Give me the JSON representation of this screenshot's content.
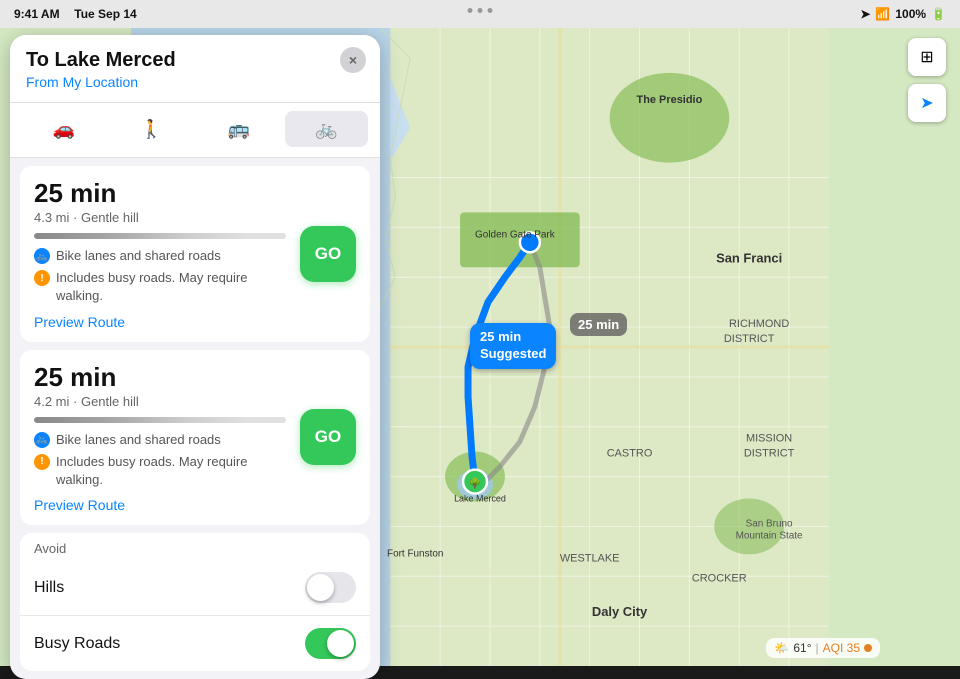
{
  "statusBar": {
    "time": "9:41 AM",
    "date": "Tue Sep 14",
    "signal": "●●●",
    "wifi": "WiFi",
    "battery": "100%"
  },
  "panel": {
    "title": "To Lake Merced",
    "fromLabel": "From",
    "fromLocation": "My Location",
    "closeButton": "×",
    "transportModes": [
      {
        "icon": "🚗",
        "label": "Drive",
        "active": false
      },
      {
        "icon": "🚶",
        "label": "Walk",
        "active": false
      },
      {
        "icon": "🚌",
        "label": "Transit",
        "active": false
      },
      {
        "icon": "🚲",
        "label": "Bike",
        "active": true
      }
    ],
    "routes": [
      {
        "time": "25 min",
        "distance": "4.3 mi",
        "terrain": "Gentle hill",
        "bikeInfo": "Bike lanes and shared roads",
        "warning": "Includes busy roads. May require walking.",
        "goLabel": "GO",
        "previewLabel": "Preview Route",
        "suggested": true
      },
      {
        "time": "25 min",
        "distance": "4.2 mi",
        "terrain": "Gentle hill",
        "bikeInfo": "Bike lanes and shared roads",
        "warning": "Includes busy roads. May require walking.",
        "goLabel": "GO",
        "previewLabel": "Preview Route",
        "suggested": false
      }
    ],
    "avoid": {
      "title": "Avoid",
      "options": [
        {
          "label": "Hills",
          "enabled": false
        },
        {
          "label": "Busy Roads",
          "enabled": true
        }
      ]
    }
  },
  "map": {
    "routeBubble": {
      "time": "25 min",
      "label": "Suggested"
    },
    "altRouteBubble": {
      "time": "25 min"
    },
    "weather": {
      "icon": "🌤️",
      "temp": "61°",
      "aqi": "AQI 35"
    },
    "layersIcon": "⊞",
    "locationIcon": "➤"
  }
}
